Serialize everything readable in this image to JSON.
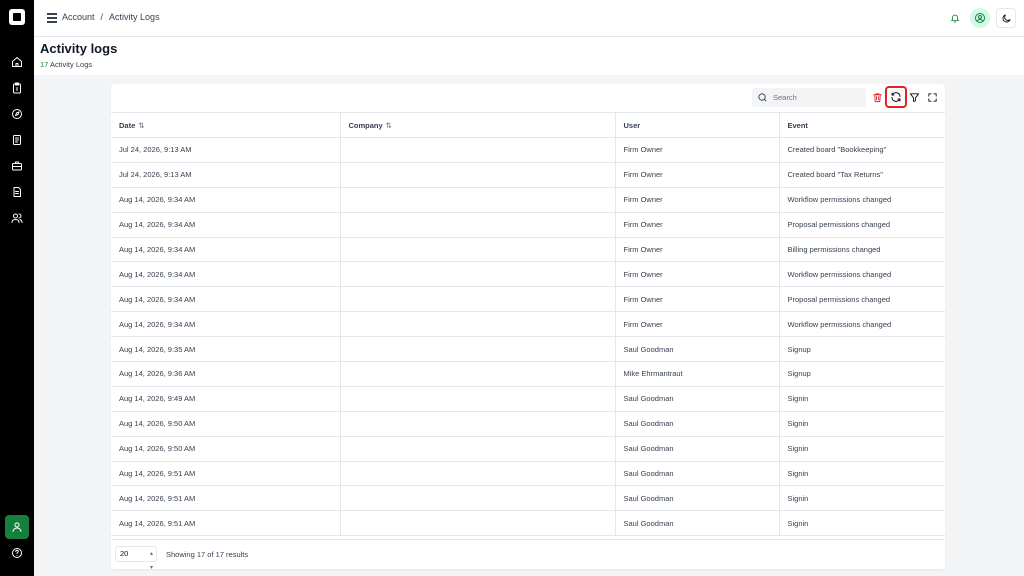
{
  "breadcrumb": {
    "parent": "Account",
    "separator": "/",
    "current": "Activity Logs"
  },
  "page": {
    "title": "Activity logs",
    "count": "17",
    "count_label": "Activity Logs"
  },
  "toolbar": {
    "search_placeholder": "Search"
  },
  "table": {
    "columns": [
      "Date",
      "Company",
      "User",
      "Event"
    ],
    "sort_glyph": "⇅",
    "rows": [
      {
        "date": "Jul 24, 2026, 9:13 AM",
        "company": "",
        "user": "Firm Owner",
        "event": "Created board \"Bookkeeping\""
      },
      {
        "date": "Jul 24, 2026, 9:13 AM",
        "company": "",
        "user": "Firm Owner",
        "event": "Created board \"Tax Returns\""
      },
      {
        "date": "Aug 14, 2026, 9:34 AM",
        "company": "",
        "user": "Firm Owner",
        "event": "Workflow permissions changed"
      },
      {
        "date": "Aug 14, 2026, 9:34 AM",
        "company": "",
        "user": "Firm Owner",
        "event": "Proposal permissions changed"
      },
      {
        "date": "Aug 14, 2026, 9:34 AM",
        "company": "",
        "user": "Firm Owner",
        "event": "Billing permissions changed"
      },
      {
        "date": "Aug 14, 2026, 9:34 AM",
        "company": "",
        "user": "Firm Owner",
        "event": "Workflow permissions changed"
      },
      {
        "date": "Aug 14, 2026, 9:34 AM",
        "company": "",
        "user": "Firm Owner",
        "event": "Proposal permissions changed"
      },
      {
        "date": "Aug 14, 2026, 9:34 AM",
        "company": "",
        "user": "Firm Owner",
        "event": "Workflow permissions changed"
      },
      {
        "date": "Aug 14, 2026, 9:35 AM",
        "company": "",
        "user": "Saul Goodman",
        "event": "Signup"
      },
      {
        "date": "Aug 14, 2026, 9:36 AM",
        "company": "",
        "user": "Mike Ehrmantraut",
        "event": "Signup"
      },
      {
        "date": "Aug 14, 2026, 9:49 AM",
        "company": "",
        "user": "Saul Goodman",
        "event": "Signin"
      },
      {
        "date": "Aug 14, 2026, 9:50 AM",
        "company": "",
        "user": "Saul Goodman",
        "event": "Signin"
      },
      {
        "date": "Aug 14, 2026, 9:50 AM",
        "company": "",
        "user": "Saul Goodman",
        "event": "Signin"
      },
      {
        "date": "Aug 14, 2026, 9:51 AM",
        "company": "",
        "user": "Saul Goodman",
        "event": "Signin"
      },
      {
        "date": "Aug 14, 2026, 9:51 AM",
        "company": "",
        "user": "Saul Goodman",
        "event": "Signin"
      },
      {
        "date": "Aug 14, 2026, 9:51 AM",
        "company": "",
        "user": "Saul Goodman",
        "event": "Signin"
      }
    ]
  },
  "footer": {
    "page_size": "20",
    "results": "Showing 17 of 17 results"
  },
  "colors": {
    "accent": "#15803d",
    "danger": "#dc2626",
    "sidebar": "#000000"
  },
  "icons": {
    "sidebar": [
      "home-icon",
      "clipboard-icon",
      "compass-icon",
      "document-icon",
      "briefcase-icon",
      "file-icon",
      "users-icon",
      "user-icon",
      "help-icon"
    ],
    "toolbar": [
      "search-icon",
      "trash-icon",
      "refresh-icon",
      "filter-icon",
      "fullscreen-icon"
    ],
    "topbar": [
      "menu-icon",
      "bell-icon",
      "user-circle-icon",
      "moon-icon"
    ]
  }
}
